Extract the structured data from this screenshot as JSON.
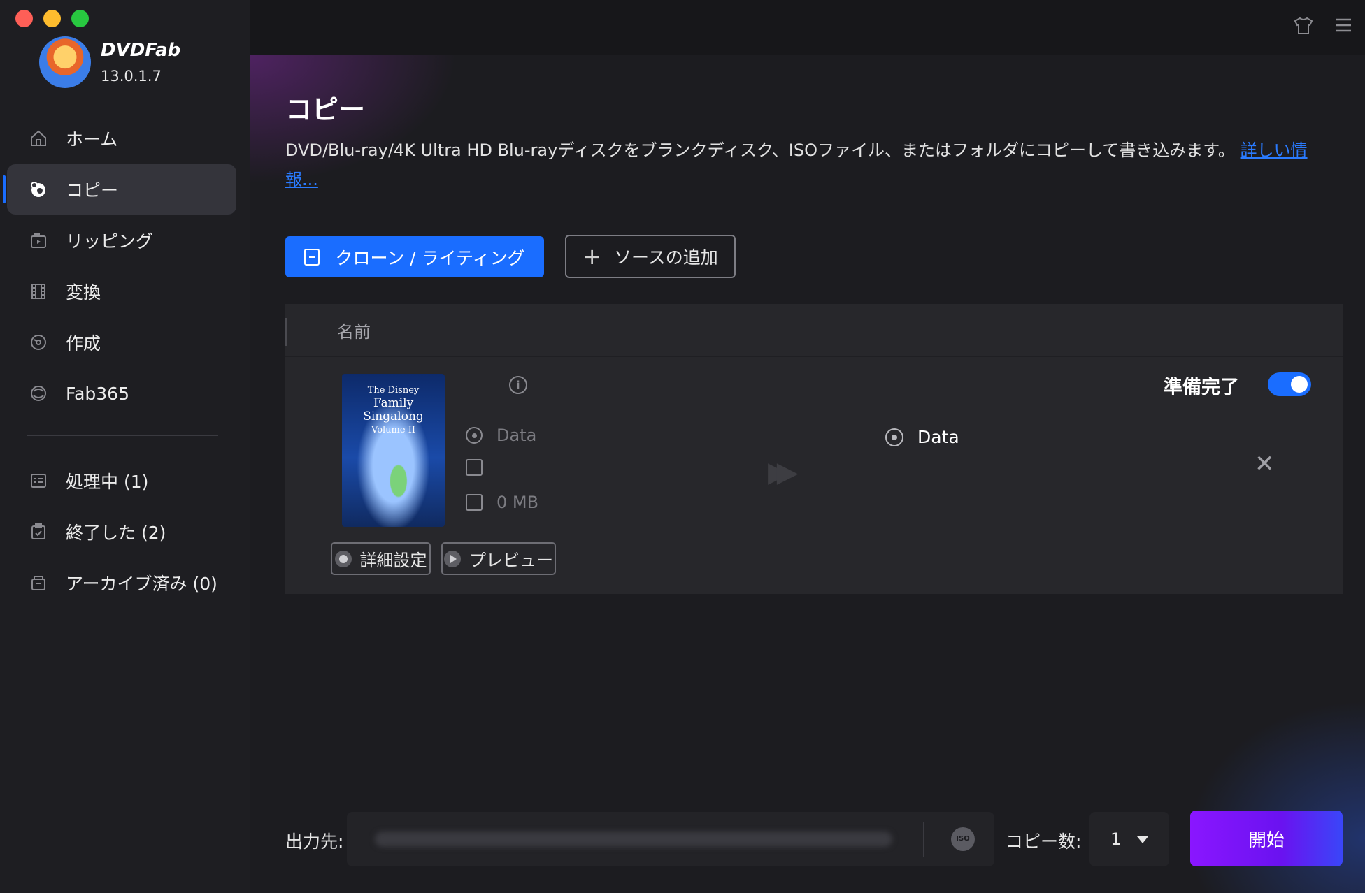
{
  "window": {
    "traffic_lights": [
      "close",
      "minimize",
      "zoom"
    ]
  },
  "brand": {
    "name": "DVDFab",
    "version": "13.0.1.7"
  },
  "sidebar": {
    "items": [
      {
        "label": "ホーム",
        "icon": "home-icon"
      },
      {
        "label": "コピー",
        "icon": "copy-disc-icon",
        "active": true
      },
      {
        "label": "リッピング",
        "icon": "ripper-icon"
      },
      {
        "label": "変換",
        "icon": "film-icon"
      },
      {
        "label": "作成",
        "icon": "creator-disc-icon"
      },
      {
        "label": "Fab365",
        "icon": "fab365-icon"
      }
    ],
    "queue": [
      {
        "label": "処理中 (1)",
        "icon": "processing-list-icon"
      },
      {
        "label": "終了した (2)",
        "icon": "finished-clipboard-icon"
      },
      {
        "label": "アーカイブ済み (0)",
        "icon": "archive-box-icon"
      }
    ]
  },
  "topbar": {
    "icons": [
      "shirt-skin-icon",
      "menu-icon"
    ]
  },
  "main": {
    "title": "コピー",
    "description": "DVD/Blu-ray/4K Ultra HD Blu-rayディスクをブランクディスク、ISOファイル、またはフォルダにコピーして書き込みます。",
    "more_link": "詳しい情報...",
    "mode_button": "クローン / ライティング",
    "add_source_button": "ソースの追加",
    "table": {
      "column_name": "名前",
      "item": {
        "poster_title_small": "The Disney",
        "poster_title": "Family Singalong",
        "poster_subtitle": "Volume II",
        "source_label": "Data",
        "size": "0 MB",
        "dest_label": "Data",
        "status": "準備完了",
        "toggle_on": true,
        "settings_button": "詳細設定",
        "preview_button": "プレビュー"
      }
    }
  },
  "footer": {
    "output_label": "出力先:",
    "iso_label": "ISO",
    "copies_label": "コピー数:",
    "copies_value": "1",
    "start_button": "開始"
  },
  "colors": {
    "accent": "#1a6dff",
    "start_gradient_start": "#8a16ff",
    "start_gradient_end": "#3a46f8"
  }
}
